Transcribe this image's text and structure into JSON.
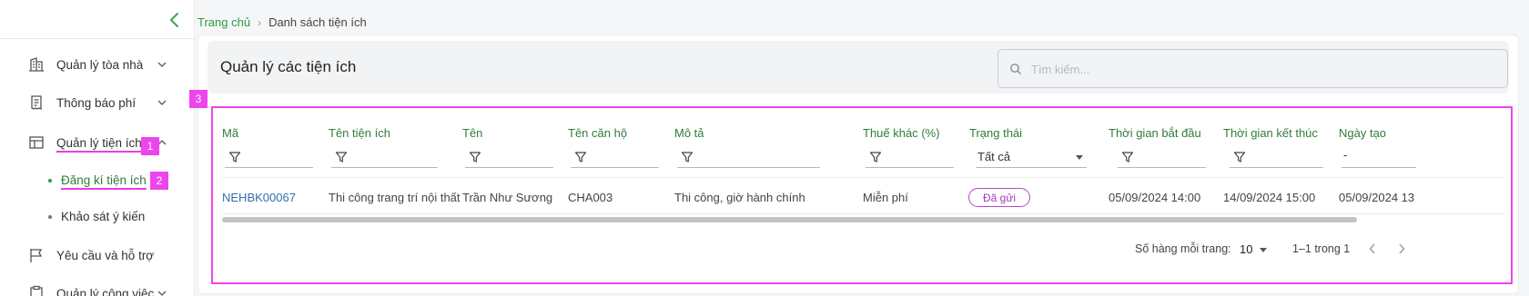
{
  "breadcrumb": {
    "home": "Trang chủ",
    "separator": "›",
    "current": "Danh sách tiện ích"
  },
  "sidebar": {
    "items": [
      {
        "label": "Quản lý tòa nhà",
        "icon": "building-icon",
        "expanded": false
      },
      {
        "label": "Thông báo phí",
        "icon": "receipt-icon",
        "expanded": false
      },
      {
        "label": "Quản lý tiện ích",
        "icon": "layout-icon",
        "expanded": true,
        "children": [
          {
            "label": "Đăng kí tiện ích",
            "active": true
          },
          {
            "label": "Khảo sát ý kiến",
            "active": false
          }
        ]
      },
      {
        "label": "Yêu cầu và hỗ trợ",
        "icon": "flag-icon"
      },
      {
        "label": "Quản lý công việc",
        "icon": "clipboard-icon",
        "expanded": false
      }
    ]
  },
  "annotations": {
    "label1": "1",
    "label2": "2",
    "label3": "3"
  },
  "page": {
    "title": "Quản lý các tiện ích"
  },
  "search": {
    "placeholder": "Tìm kiếm..."
  },
  "table": {
    "columns": [
      "Mã",
      "Tên tiện ích",
      "Tên",
      "Tên căn hộ",
      "Mô tả",
      "Thuế khác (%)",
      "Trạng thái",
      "Thời gian bắt đầu",
      "Thời gian kết thúc",
      "Ngày tạo"
    ],
    "status_filter": "Tất cả",
    "date_filter": "-",
    "rows": [
      {
        "code": "NEHBK00067",
        "utility": "Thi công trang trí nội thất",
        "name": "Trần Như Sương",
        "apartment": "CHA003",
        "description": "Thi công, giờ hành chính",
        "tax": "Miễn phí",
        "status": "Đã gửi",
        "start": "05/09/2024 14:00",
        "end": "14/09/2024 15:00",
        "created": "05/09/2024 13"
      }
    ]
  },
  "pagination": {
    "rows_label": "Số hàng mỗi trang:",
    "rows_value": "10",
    "range": "1–1 trong 1"
  },
  "colors": {
    "accent": "#2f9a43",
    "annotation": "#ee44ee",
    "link": "#2f6fb0",
    "status": "#a43bb8"
  }
}
